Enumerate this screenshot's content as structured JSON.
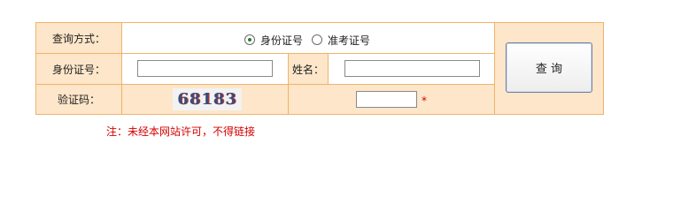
{
  "query_form": {
    "method_label": "查询方式：",
    "method_options": [
      "身份证号",
      "准考证号"
    ],
    "method_selected": "身份证号",
    "id_label": "身份证号：",
    "id_value": "",
    "name_label": "姓名：",
    "name_value": "",
    "captcha_label": "验证码：",
    "captcha_code": "68183",
    "captcha_value": "",
    "required_mark": "*",
    "submit_label": "查 询"
  },
  "note": "注：未经本网站许可，不得链接",
  "colors": {
    "panel_bg": "#fde6c9",
    "panel_border": "#f0b36a",
    "note_red": "#d40000",
    "radio_green": "#2d7a33"
  }
}
